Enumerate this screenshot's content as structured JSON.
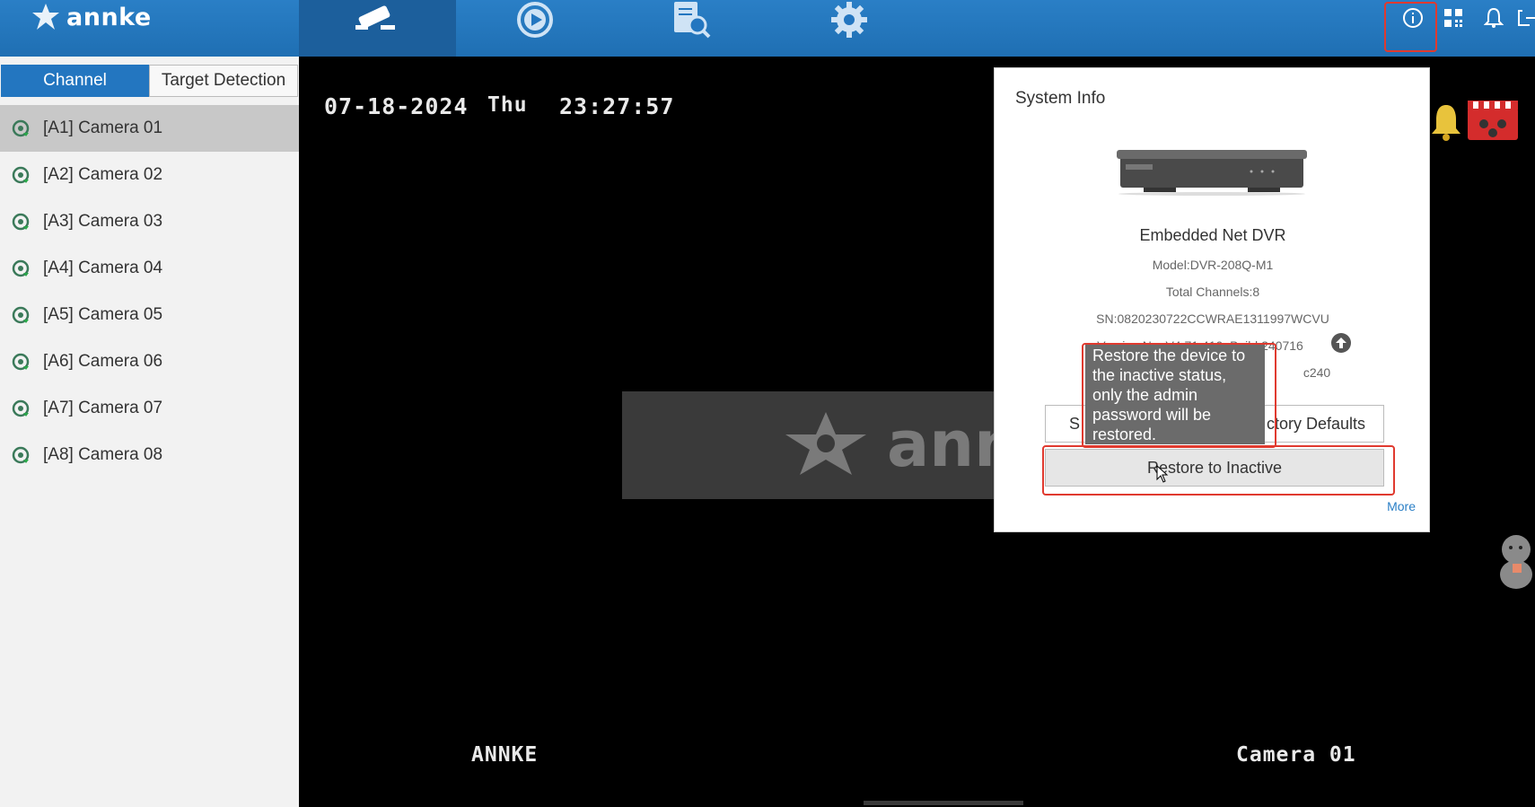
{
  "app": {
    "brand": "annke"
  },
  "topnav": {
    "items": [
      "live-view",
      "playback",
      "search",
      "configuration"
    ],
    "right_icons": [
      "info",
      "qr-code",
      "notifications",
      "logout"
    ]
  },
  "sidebar": {
    "tabs": [
      {
        "label": "Channel",
        "active": true
      },
      {
        "label": "Target Detection",
        "active": false
      }
    ],
    "cameras": [
      {
        "label": "[A1] Camera 01",
        "selected": true
      },
      {
        "label": "[A2] Camera 02",
        "selected": false
      },
      {
        "label": "[A3] Camera 03",
        "selected": false
      },
      {
        "label": "[A4] Camera 04",
        "selected": false
      },
      {
        "label": "[A5] Camera 05",
        "selected": false
      },
      {
        "label": "[A6] Camera 06",
        "selected": false
      },
      {
        "label": "[A7] Camera 07",
        "selected": false
      },
      {
        "label": "[A8] Camera 08",
        "selected": false
      }
    ]
  },
  "video": {
    "date": "07-18-2024",
    "weekday": "Thu",
    "time": "23:27:57",
    "bottom_left_label": "ANNKE",
    "bottom_right_label": "Camera 01",
    "watermark": "ann"
  },
  "system_info": {
    "title": "System Info",
    "device_name": "Embedded Net DVR",
    "model": "Model:DVR-208Q-M1",
    "total_channels": "Total Channels:8",
    "serial": "SN:0820230722CCWRAE1311997WCVU",
    "version": "Version No.:V4.71.410, Build 240716",
    "extra_line_tail": "c240",
    "left_button_prefix": "S",
    "left_button_suffix": "ctory Defaults",
    "restore_inactive_button": "Restore to Inactive",
    "more_link": "More"
  },
  "tooltip": {
    "text": "Restore the device to the inactive status, only the admin password will be restored."
  },
  "colors": {
    "topbar": "#2376c0",
    "highlight_border": "#e03a2f",
    "tab_active": "#2376c0"
  }
}
